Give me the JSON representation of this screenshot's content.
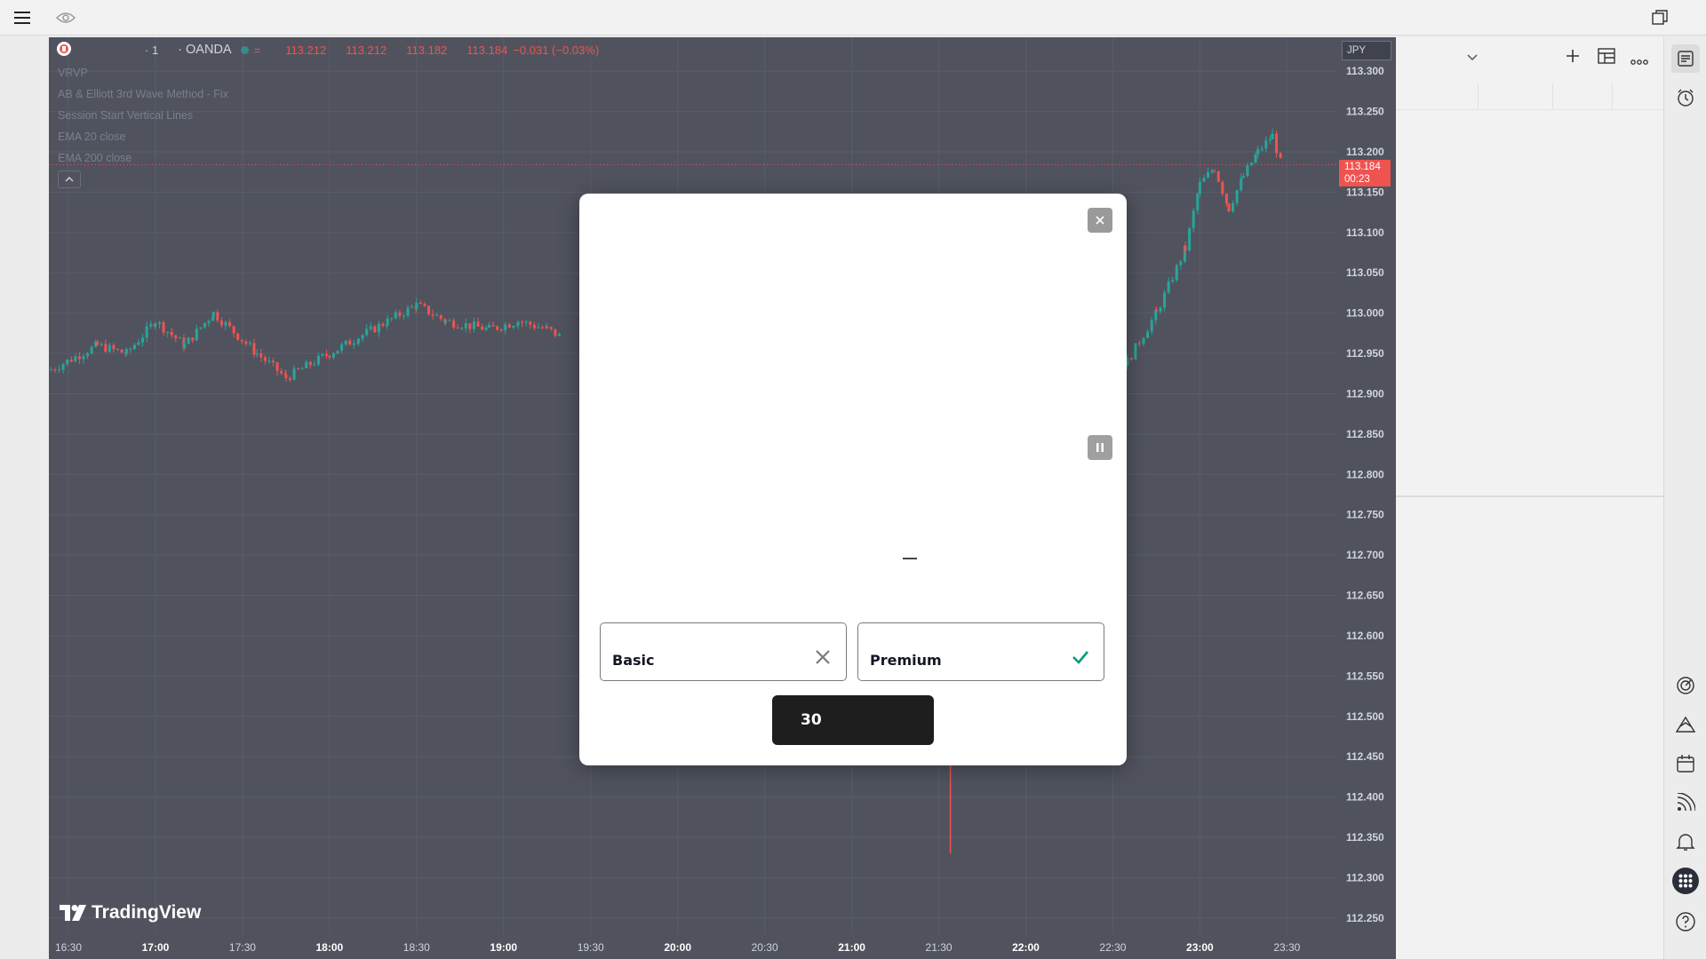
{
  "topbar": {
    "menu_icon": "hamburger-menu-icon",
    "eye_icon": "eye-icon",
    "window_icon": "restore-window-icon"
  },
  "legend": {
    "interval": "· 1",
    "exchange": "· OANDA",
    "open": "113.212",
    "high": "113.212",
    "low": "113.182",
    "close": "113.184",
    "change": "−0.031 (−0.03%)"
  },
  "indicators": [
    "VRVP",
    "AB & Elliott 3rd Wave Method - Fix",
    "Session Start Vertical Lines",
    "EMA 20 close",
    "EMA 200 close"
  ],
  "currency_badge": "JPY",
  "current_price": {
    "price": "113.184",
    "countdown": "00:23"
  },
  "brand": "TradingView",
  "chart_data": {
    "type": "candlestick",
    "symbol_exchange": "OANDA",
    "currency": "JPY",
    "y_ticks": [
      "113.300",
      "113.250",
      "113.200",
      "113.150",
      "113.100",
      "113.050",
      "113.000",
      "112.950",
      "112.900",
      "112.850",
      "112.800",
      "112.750",
      "112.700",
      "112.650",
      "112.600",
      "112.550",
      "112.500",
      "112.450",
      "112.400",
      "112.350",
      "112.300",
      "112.250"
    ],
    "ylim": [
      112.23,
      113.32
    ],
    "x_ticks": [
      {
        "label": "16:30",
        "bold": false
      },
      {
        "label": "17:00",
        "bold": true
      },
      {
        "label": "17:30",
        "bold": false
      },
      {
        "label": "18:00",
        "bold": true
      },
      {
        "label": "18:30",
        "bold": false
      },
      {
        "label": "19:00",
        "bold": true
      },
      {
        "label": "19:30",
        "bold": false
      },
      {
        "label": "20:00",
        "bold": true
      },
      {
        "label": "20:30",
        "bold": false
      },
      {
        "label": "21:00",
        "bold": true
      },
      {
        "label": "21:30",
        "bold": false
      },
      {
        "label": "22:00",
        "bold": true
      },
      {
        "label": "22:30",
        "bold": false
      },
      {
        "label": "23:00",
        "bold": true
      },
      {
        "label": "23:30",
        "bold": false
      }
    ],
    "x_start_minutes": 990,
    "x_end_minutes": 1420,
    "last_price": 113.184,
    "approx_close_path": [
      {
        "t": "16:24",
        "v": 112.93
      },
      {
        "t": "16:40",
        "v": 112.96
      },
      {
        "t": "16:50",
        "v": 112.95
      },
      {
        "t": "17:00",
        "v": 112.99
      },
      {
        "t": "17:10",
        "v": 112.96
      },
      {
        "t": "17:20",
        "v": 113.0
      },
      {
        "t": "17:35",
        "v": 112.95
      },
      {
        "t": "17:45",
        "v": 112.92
      },
      {
        "t": "18:00",
        "v": 112.95
      },
      {
        "t": "18:10",
        "v": 112.97
      },
      {
        "t": "18:20",
        "v": 112.99
      },
      {
        "t": "18:30",
        "v": 113.01
      },
      {
        "t": "18:40",
        "v": 112.99
      },
      {
        "t": "18:55",
        "v": 112.98
      },
      {
        "t": "19:05",
        "v": 112.99
      },
      {
        "t": "19:15",
        "v": 112.98
      },
      {
        "t": "19:20",
        "v": 112.97
      },
      {
        "t": "22:15",
        "v": 112.86
      },
      {
        "t": "22:25",
        "v": 112.91
      },
      {
        "t": "22:35",
        "v": 112.94
      },
      {
        "t": "22:45",
        "v": 113.0
      },
      {
        "t": "22:55",
        "v": 113.08
      },
      {
        "t": "23:00",
        "v": 113.16
      },
      {
        "t": "23:05",
        "v": 113.18
      },
      {
        "t": "23:10",
        "v": 113.13
      },
      {
        "t": "23:15",
        "v": 113.17
      },
      {
        "t": "23:20",
        "v": 113.2
      },
      {
        "t": "23:25",
        "v": 113.22
      },
      {
        "t": "23:28",
        "v": 113.184
      }
    ],
    "spike": {
      "t": "21:34",
      "high": 112.48,
      "low": 112.33
    }
  },
  "modal": {
    "close_icon": "close-icon",
    "pause_icon": "pause-icon",
    "options": [
      {
        "label": "Basic",
        "icon": "x-icon",
        "icon_color": "#7a7a7a"
      },
      {
        "label": "Premium",
        "icon": "check-icon",
        "icon_color": "#089981"
      }
    ],
    "cta_label": "30"
  },
  "right_panel": {
    "chevron_icon": "chevron-down-icon",
    "add_icon": "plus-icon",
    "layout_icon": "table-layout-icon",
    "more_icon": "more-dots-icon"
  },
  "sidebar": [
    {
      "icon": "watchlist-icon"
    },
    {
      "icon": "alert-clock-icon"
    },
    {
      "icon": "target-icon"
    },
    {
      "icon": "ideas-icon"
    },
    {
      "icon": "calendar-icon"
    },
    {
      "icon": "news-feed-icon"
    },
    {
      "icon": "notification-bell-icon"
    },
    {
      "icon": "apps-grid-icon"
    },
    {
      "icon": "help-icon"
    }
  ],
  "colors": {
    "chart_bg": "#50535e",
    "up": "#26a69a",
    "down": "#ef5350",
    "price_tag": "#ef5350"
  }
}
